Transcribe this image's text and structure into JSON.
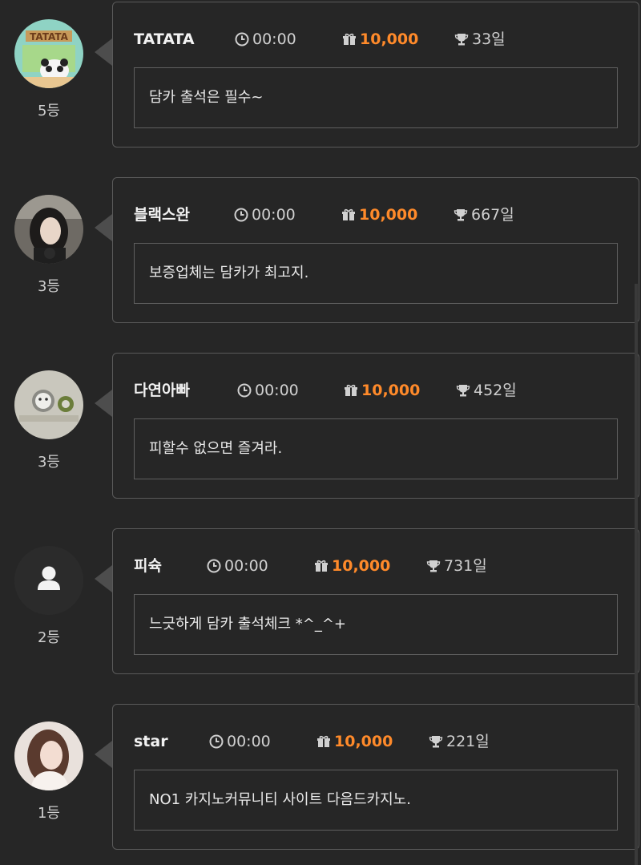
{
  "entries": [
    {
      "name": "TATATA",
      "time": "00:00",
      "points": "10,000",
      "days": "33일",
      "message": "담카 출석은 필수~",
      "rank": "5등",
      "avatar": "tatata-avatar"
    },
    {
      "name": "블랙스완",
      "time": "00:00",
      "points": "10,000",
      "days": "667일",
      "message": "보증업체는 담카가 최고지.",
      "rank": "3등",
      "avatar": "photo-avatar"
    },
    {
      "name": "다연아빠",
      "time": "00:00",
      "points": "10,000",
      "days": "452일",
      "message": "피할수 없으면 즐겨라.",
      "rank": "3등",
      "avatar": "drawing-avatar"
    },
    {
      "name": "피슉",
      "time": "00:00",
      "points": "10,000",
      "days": "731일",
      "message": "느긋하게 담카 출석체크 *^_^+",
      "rank": "2등",
      "avatar": "default-user-icon"
    },
    {
      "name": "star",
      "time": "00:00",
      "points": "10,000",
      "days": "221일",
      "message": "NO1 카지노커뮤니티 사이트 다음드카지노.",
      "rank": "1등",
      "avatar": "photo-avatar"
    }
  ],
  "colors": {
    "background": "#262626",
    "border": "#5a5a5a",
    "points": "#ff8a2a"
  },
  "icons": {
    "time": "clock-icon",
    "points": "gift-icon",
    "days": "trophy-icon"
  }
}
